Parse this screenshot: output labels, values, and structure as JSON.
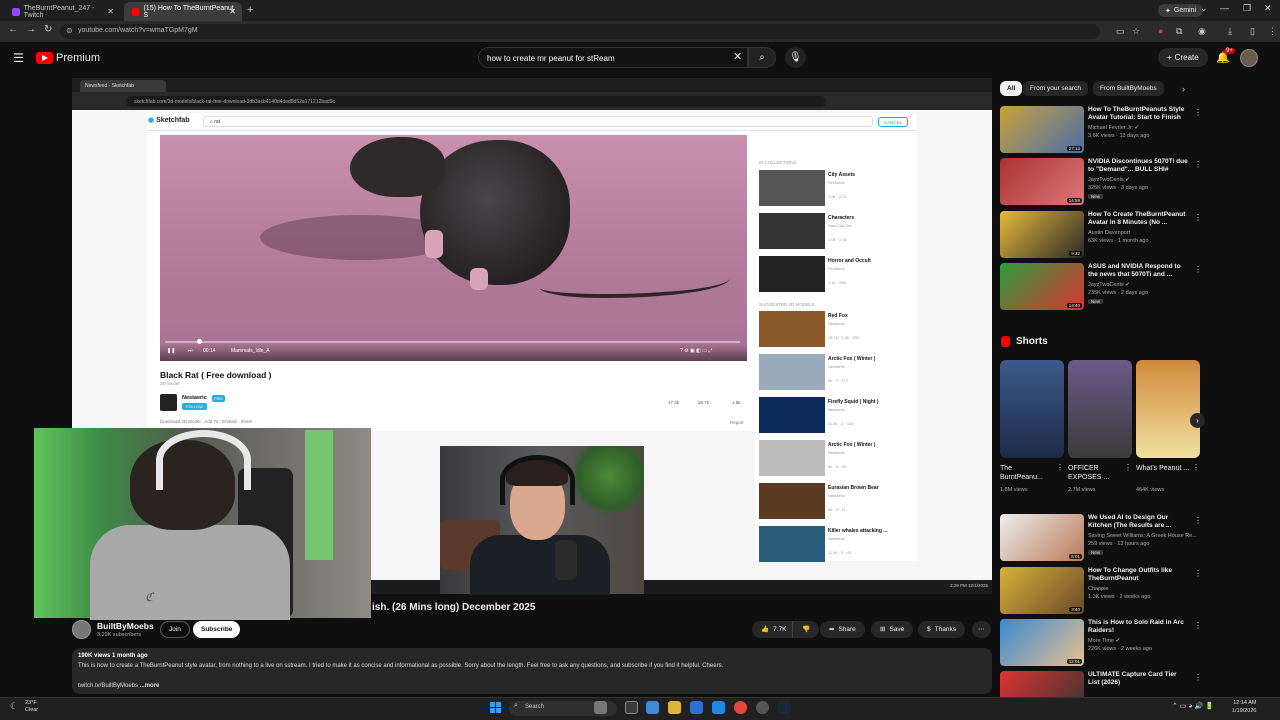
{
  "browser": {
    "tabs": [
      {
        "title": "TheBurntPeanut_247 - Twitch",
        "active": false
      },
      {
        "title": "(15) How To TheBurntPeanut S",
        "active": true
      }
    ],
    "gemini_label": "Gemini",
    "url": "youtube.com/watch?v=wmaTGpM7gM"
  },
  "youtube": {
    "logo_text": "Premium",
    "search_value": "how to create mr peanut for stReam",
    "create_label": "Create",
    "notif_count": "9+",
    "player": {
      "inner_tab": "Newsfeed - Sketchfab",
      "inner_url": "sketchfab.com/3d-models/black-rat-free-download-3db3acb4140d4ded8d62a171212bad9c",
      "sketchfab_logo": "Sketchfab",
      "sketchfab_search": "rat",
      "cancel_label": "CANCEL",
      "model_title": "Black Rat ( Free download )",
      "model_sub": "3D Model",
      "author": "Nestaeric",
      "author_badge": "PRO",
      "follow_label": "FOLLOW",
      "stats": [
        "17.3k",
        "28.7k",
        "1.5k"
      ],
      "actions": "Download 3D Model · Add To · Embed · Share",
      "report": "Report",
      "time": "00:14",
      "anim": "Mammals_Idle_A",
      "collections_head": "IN COLLECTIONS",
      "suggested_head": "SUGGESTED 3D MODELS",
      "collections": [
        {
          "title": "City Assets",
          "sub": "Firestone",
          "meta": "1.0k · 2.7k"
        },
        {
          "title": "Characters",
          "sub": "Saco Dai Dai",
          "meta": "1.0k · 2.4k"
        },
        {
          "title": "Horror and Occult",
          "sub": "Firestone",
          "meta": "1.1k · 285"
        }
      ],
      "suggested": [
        {
          "title": "Red Fox",
          "sub": "Nestaeric",
          "meta": "15.7k · 1.4k · 202"
        },
        {
          "title": "Arctic Fox ( Winter )",
          "sub": "Nestaeric",
          "meta": "5k · 7 · 177"
        },
        {
          "title": "Firefly Squid ( Night )",
          "sub": "Nestaeric",
          "meta": "11.4k · 2 · 126"
        },
        {
          "title": "Arctic Fox ( Winter )",
          "sub": "Nestaeric",
          "meta": "5k · 3 · 96"
        },
        {
          "title": "Eurasian Brown Bear",
          "sub": "Nestaeric",
          "meta": "5k · 3 · 11"
        },
        {
          "title": "Killer whales attacking ...",
          "sub": "Nestaeric",
          "meta": "11.4k · 3 · 43"
        }
      ],
      "in_time": "3:29 PM 12/1/2025"
    },
    "video": {
      "title_visible": "ish. (26 Mins long) December 2025",
      "channel": "BuiltByMoebs",
      "subs": "3.29K subscribers",
      "join": "Join",
      "subscribe": "Subscribe",
      "likes": "7.7K",
      "share": "Share",
      "save": "Save",
      "thanks": "Thanks",
      "views_date": "190K views  1 month ago",
      "description": "This is how to create a TheBurntPeanut style avatar, from nothing to a live on sstream. I tried to make it as concise and informational as possible. Sorry about the length. Feel free to ask any questions, and subscribe if you find it helpful. Cheers.",
      "desc_link": "twitch.tv/BuiltByMoebs",
      "more": "...more"
    },
    "chips": [
      "All",
      "From your search",
      "From BuiltByMoebs"
    ],
    "recs": [
      {
        "title": "How To TheBurntPeanuts Style Avatar Tutorial: Start to Finish",
        "channel": "Michael Fevrier Jr.",
        "meta": "3.6K views · 13 days ago",
        "dur": "27:13",
        "new": false,
        "verified": true
      },
      {
        "title": "NVIDIA Discontinues 5070Ti due to \"Demand\"... BULL SHI#",
        "channel": "JayzTwoCents",
        "meta": "325K views · 3 days ago",
        "dur": "14:59",
        "new": true,
        "verified": true
      },
      {
        "title": "How To Create TheBurntPeanut Avatar In 8 Minutes (No ...",
        "channel": "Austin Davenport",
        "meta": "63K views · 1 month ago",
        "dur": "9:32",
        "new": false,
        "verified": false
      },
      {
        "title": "ASUS and NVIDIA Respond to the news that 5070Ti and ...",
        "channel": "JayzTwoCents",
        "meta": "235K views · 2 days ago",
        "dur": "14:40",
        "new": true,
        "verified": true
      }
    ],
    "shorts_title": "Shorts",
    "shorts": [
      {
        "title": "The BurntPeanu...",
        "views": "1.8M views"
      },
      {
        "title": "OFFICER EXPOSES ...",
        "views": "2.7M views"
      },
      {
        "title": "What's Peanut ...",
        "views": "464K views"
      }
    ],
    "recs2": [
      {
        "title": "We Used AI to Design Our Kitchen (The Results are ...",
        "channel": "Saving Sweet Williams: A Greek House Re...",
        "meta": "259 views · 13 hours ago",
        "dur": "6:01",
        "new": true,
        "verified": false
      },
      {
        "title": "How To Change Outfits like TheBurntPeanut",
        "channel": "Chappie",
        "meta": "1.3K views · 2 weeks ago",
        "dur": "3:40",
        "new": false,
        "verified": false
      },
      {
        "title": "This is How to Solo Raid in Arc Raiders!",
        "channel": "More Time",
        "meta": "226K views · 2 weeks ago",
        "dur": "12:01",
        "new": false,
        "verified": true
      },
      {
        "title": "ULTIMATE Capture Card Tier List (2026)",
        "channel": "",
        "meta": "",
        "dur": "",
        "new": false,
        "verified": false
      }
    ]
  },
  "taskbar": {
    "weather_temp": "23°F",
    "weather_desc": "Clear",
    "search_label": "Search",
    "time": "12:14 AM",
    "date": "1/19/2026"
  },
  "colors": {
    "youtube_red": "#ff0000",
    "sketchfab_blue": "#1caad9",
    "viewer_bg": "#c890ad"
  }
}
